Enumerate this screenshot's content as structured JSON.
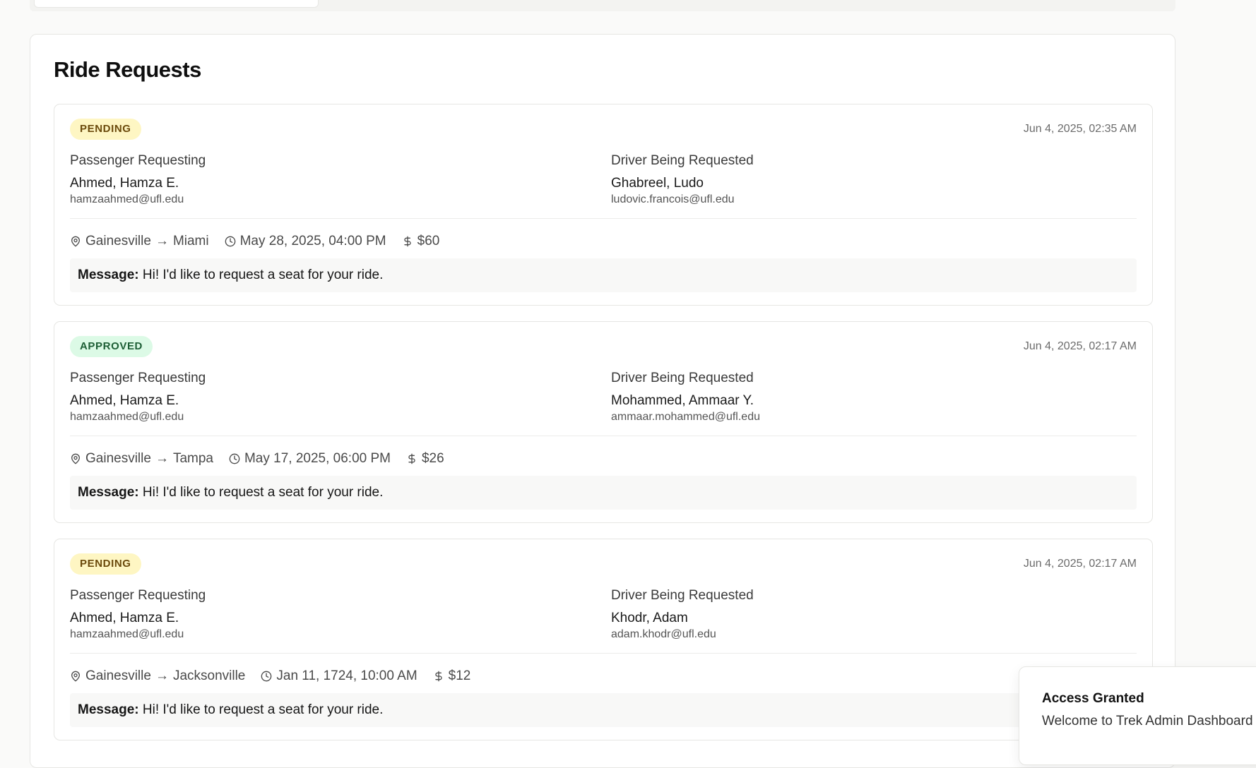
{
  "panel": {
    "title": "Ride Requests"
  },
  "requests": [
    {
      "status": "PENDING",
      "created": "Jun 4, 2025, 02:35 AM",
      "passenger": {
        "label": "Passenger Requesting",
        "name": "Ahmed, Hamza E.",
        "email": "hamzaahmed@ufl.edu"
      },
      "driver": {
        "label": "Driver Being Requested",
        "name": "Ghabreel, Ludo",
        "email": "ludovic.francois@ufl.edu"
      },
      "origin": "Gainesville",
      "destination": "Miami",
      "departure": "May 28, 2025, 04:00 PM",
      "price": "$60",
      "message_label": "Message:",
      "message": "Hi! I'd like to request a seat for your ride."
    },
    {
      "status": "APPROVED",
      "created": "Jun 4, 2025, 02:17 AM",
      "passenger": {
        "label": "Passenger Requesting",
        "name": "Ahmed, Hamza E.",
        "email": "hamzaahmed@ufl.edu"
      },
      "driver": {
        "label": "Driver Being Requested",
        "name": "Mohammed, Ammaar Y.",
        "email": "ammaar.mohammed@ufl.edu"
      },
      "origin": "Gainesville",
      "destination": "Tampa",
      "departure": "May 17, 2025, 06:00 PM",
      "price": "$26",
      "message_label": "Message:",
      "message": "Hi! I'd like to request a seat for your ride."
    },
    {
      "status": "PENDING",
      "created": "Jun 4, 2025, 02:17 AM",
      "passenger": {
        "label": "Passenger Requesting",
        "name": "Ahmed, Hamza E.",
        "email": "hamzaahmed@ufl.edu"
      },
      "driver": {
        "label": "Driver Being Requested",
        "name": "Khodr, Adam",
        "email": "adam.khodr@ufl.edu"
      },
      "origin": "Gainesville",
      "destination": "Jacksonville",
      "departure": "Jan 11, 1724, 10:00 AM",
      "price": "$12",
      "message_label": "Message:",
      "message": "Hi! I'd like to request a seat for your ride."
    }
  ],
  "toast": {
    "title": "Access Granted",
    "description": "Welcome to Trek Admin Dashboard"
  },
  "icons": {
    "location": "map-pin-icon",
    "time": "clock-icon",
    "price": "dollar-sign-icon",
    "route": "arrow-right-icon"
  },
  "colors": {
    "pending_bg": "#fef6c3",
    "pending_text": "#6b4a0c",
    "approved_bg": "#dcfae6",
    "approved_text": "#1d5e35"
  }
}
